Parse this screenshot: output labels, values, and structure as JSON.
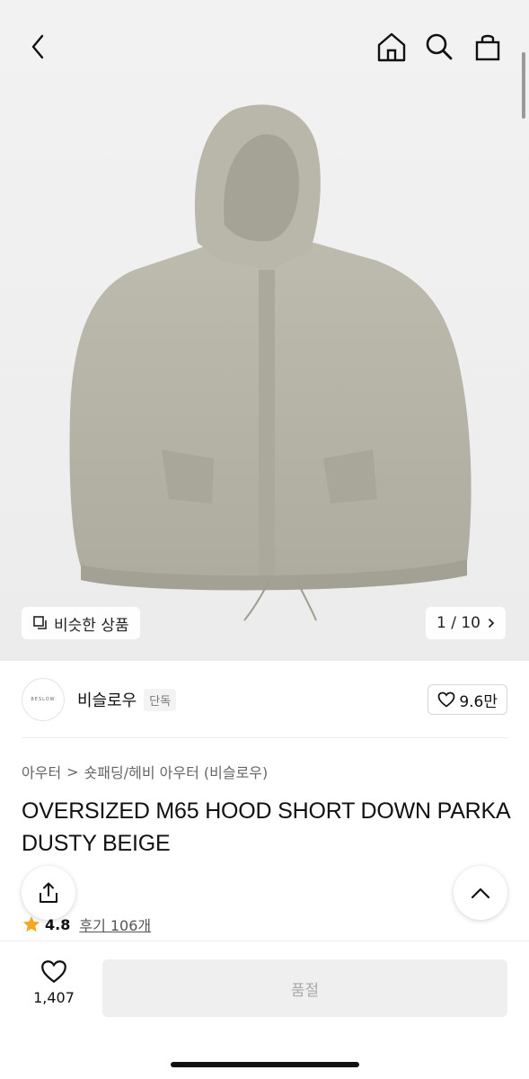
{
  "gallery": {
    "similar_label": "비슷한 상품",
    "counter": "1 / 10"
  },
  "brand": {
    "logo_text": "BESLOW",
    "name": "비슬로우",
    "tag": "단독",
    "favorite_count": "9.6만"
  },
  "breadcrumb": {
    "level1": "아우터",
    "separator": ">",
    "level2": "숏패딩/헤비 아우터 (비슬로우)"
  },
  "product": {
    "title": "OVERSIZED M65 HOOD SHORT DOWN PARKA DUSTY BEIGE",
    "rating": "4.8",
    "reviews": "후기 106개"
  },
  "bottom_bar": {
    "like_count": "1,407",
    "buy_label": "품절"
  },
  "colors": {
    "background": "#ffffff",
    "hero_bg": "#efefef",
    "jacket": "#b3b1a3",
    "star": "#f5a623",
    "disabled_button": "#efefef",
    "disabled_text": "#aaaaaa"
  },
  "icons": [
    "back-arrow-icon",
    "home-icon",
    "search-icon",
    "bag-icon",
    "similar-icon",
    "chevron-right-icon",
    "heart-icon",
    "share-icon",
    "chevron-up-icon",
    "star-icon"
  ]
}
